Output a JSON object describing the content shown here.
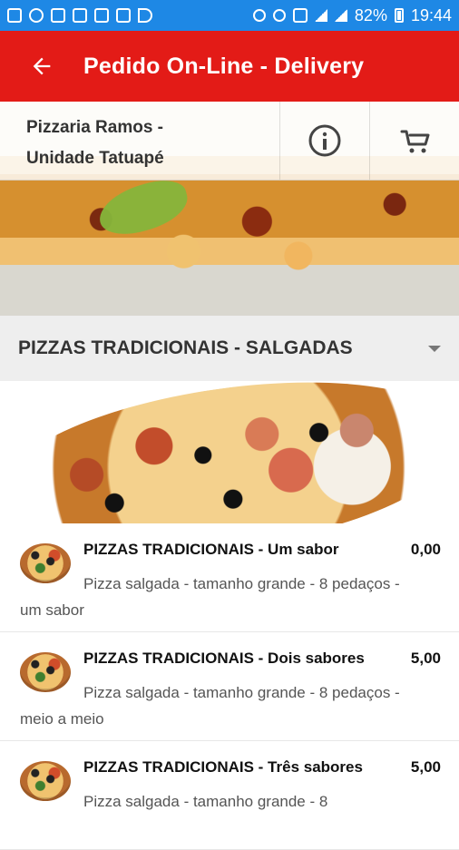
{
  "status_bar": {
    "battery_percent": "82%",
    "time": "19:44"
  },
  "app_bar": {
    "title": "Pedido On-Line - Delivery"
  },
  "store": {
    "name_line1": "Pizzaria Ramos -",
    "name_line2": "Unidade Tatuapé",
    "info_icon": "info-icon",
    "cart_icon": "cart-icon"
  },
  "category": {
    "title": "PIZZAS TRADICIONAIS - SALGADAS"
  },
  "items": [
    {
      "title": "PIZZAS TRADICIONAIS - Um sabor",
      "price": "0,00",
      "description": "Pizza salgada - tamanho grande - 8 pedaços - um sabor"
    },
    {
      "title": "PIZZAS TRADICIONAIS - Dois sabores",
      "price": "5,00",
      "description": "Pizza salgada - tamanho grande - 8 pedaços - meio a meio"
    },
    {
      "title": "PIZZAS TRADICIONAIS - Três sabores",
      "price": "5,00",
      "description": "Pizza salgada - tamanho grande - 8"
    }
  ],
  "colors": {
    "status_bar": "#1e88e5",
    "app_bar": "#e31b17"
  }
}
